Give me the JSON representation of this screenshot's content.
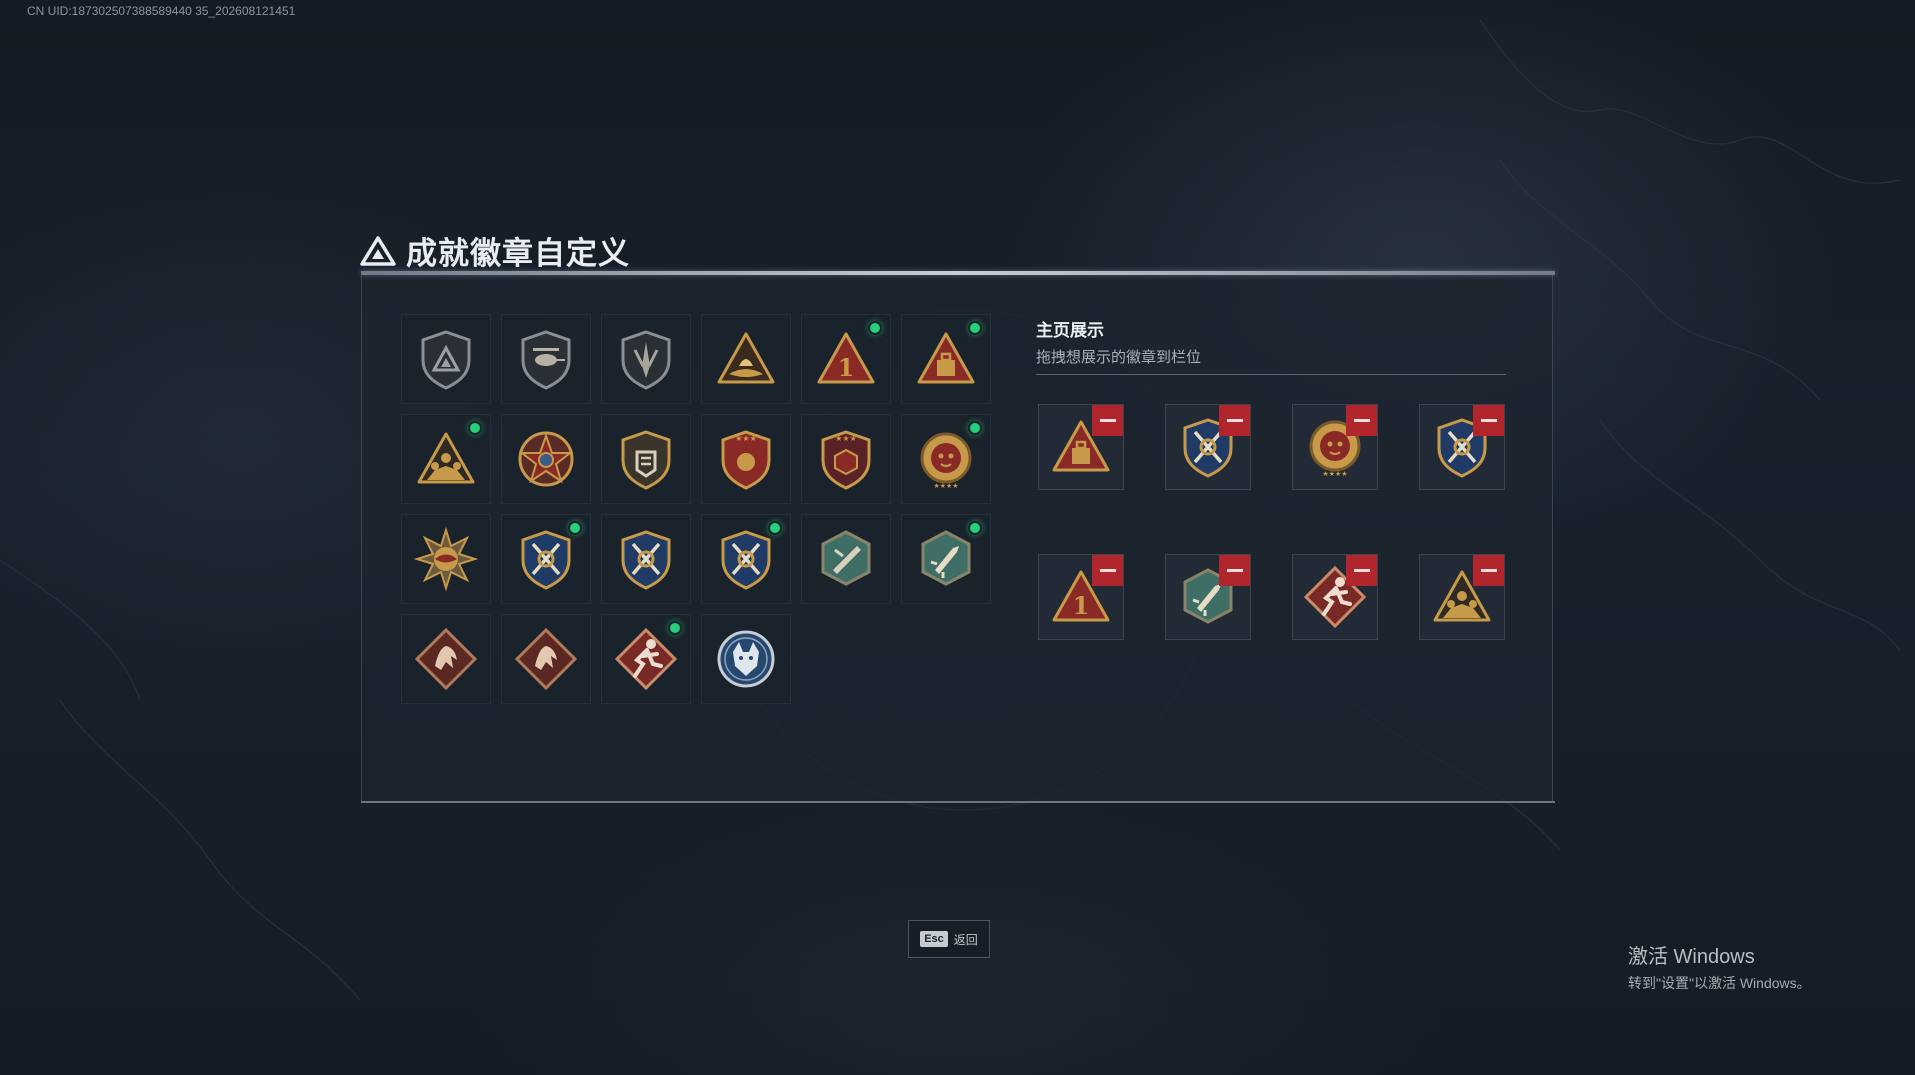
{
  "uid_text": "CN UID:187302507388589440 35_202608121451",
  "title": "成就徽章自定义",
  "display": {
    "title": "主页展示",
    "subtitle": "拖拽想展示的徽章到栏位"
  },
  "esc": {
    "key": "Esc",
    "label": "返回"
  },
  "watermark": {
    "title": "激活 Windows",
    "subtitle": "转到\"设置\"以激活 Windows。"
  },
  "colors": {
    "gold": "#c79a4a",
    "crimson": "#8a2a26",
    "navy": "#1f3b66",
    "teal": "#3f6e66",
    "new_dot": "#27d07a",
    "remove": "#b1262c"
  },
  "collection": [
    {
      "icon": "shield-emblem-icon",
      "new": false
    },
    {
      "icon": "helicopter-shield-icon",
      "new": false
    },
    {
      "icon": "arrow-shield-icon",
      "new": false
    },
    {
      "icon": "boat-triangle-icon",
      "new": false
    },
    {
      "icon": "rank-one-triangle-icon",
      "new": true
    },
    {
      "icon": "briefcase-triangle-icon",
      "new": true
    },
    {
      "icon": "squad-triangle-icon",
      "new": true
    },
    {
      "icon": "star-medal-icon",
      "new": false
    },
    {
      "icon": "fist-shield-icon",
      "new": false
    },
    {
      "icon": "navy-star-shield-icon",
      "new": false
    },
    {
      "icon": "red-star-shield-icon",
      "new": false
    },
    {
      "icon": "tiger-medal-icon",
      "new": true
    },
    {
      "icon": "spiked-sun-icon",
      "new": false
    },
    {
      "icon": "crossed-swords-shield-icon",
      "new": true
    },
    {
      "icon": "crossed-swords-shield-icon",
      "new": false
    },
    {
      "icon": "crossed-swords-shield-icon",
      "new": true
    },
    {
      "icon": "teal-hex-knife-icon",
      "new": false
    },
    {
      "icon": "teal-hex-rocket-icon",
      "new": true
    },
    {
      "icon": "dragon-diamond-icon",
      "new": false
    },
    {
      "icon": "dragon-diamond-icon",
      "new": false
    },
    {
      "icon": "runner-diamond-icon",
      "new": true
    },
    {
      "icon": "wolf-coin-icon",
      "new": false
    }
  ],
  "showcase": [
    {
      "icon": "briefcase-triangle-icon"
    },
    {
      "icon": "crossed-swords-shield-icon"
    },
    {
      "icon": "tiger-medal-icon"
    },
    {
      "icon": "crossed-swords-shield-icon"
    },
    {
      "icon": "rank-one-triangle-icon"
    },
    {
      "icon": "teal-hex-rocket-icon"
    },
    {
      "icon": "runner-diamond-icon"
    },
    {
      "icon": "squad-triangle-icon"
    }
  ]
}
